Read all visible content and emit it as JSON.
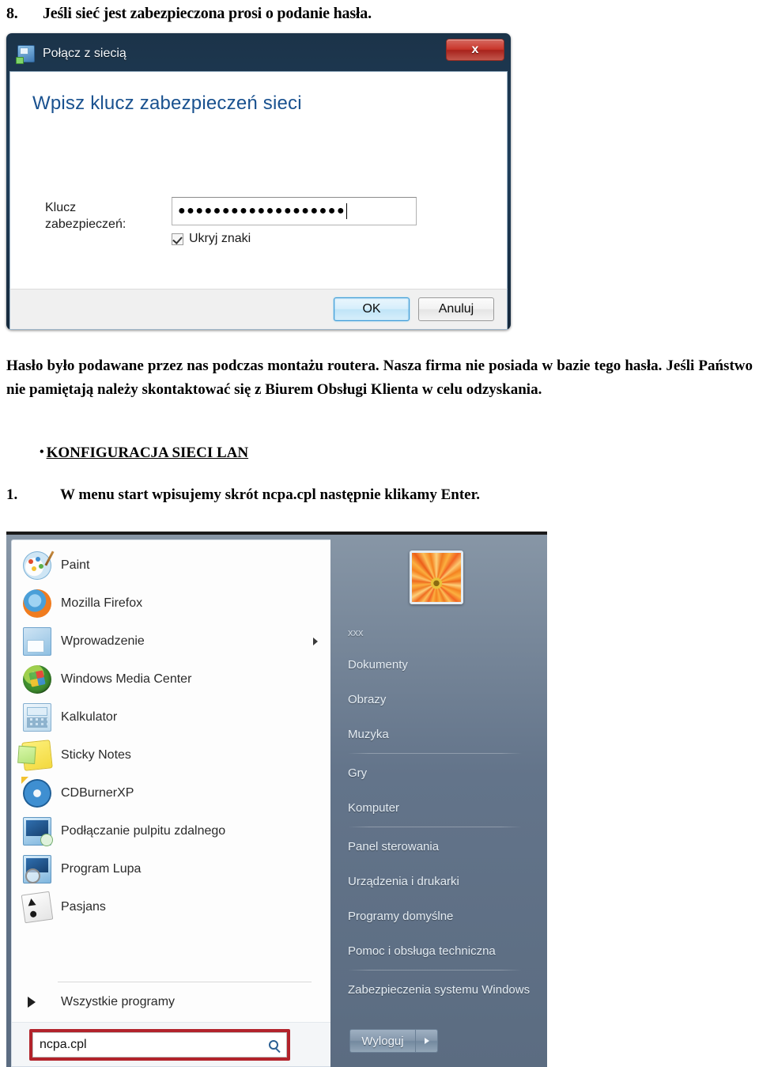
{
  "document": {
    "step8_number": "8.",
    "step8_text": "Jeśli sieć jest zabezpieczona prosi o podanie hasła.",
    "paragraph": "Hasło było podawane przez nas podczas montażu routera. Nasza firma nie posiada w bazie tego hasła. Jeśli Państwo nie pamiętają należy skontaktować się z Biurem Obsługi Klienta w celu odzyskania.",
    "bullet_heading": "KONFIGURACJA SIECI  LAN",
    "bullet_marker": "•",
    "step1_number": "1.",
    "step1_text_before": "W menu start wpisujemy skrót ",
    "step1_code": "ncpa.cpl",
    "step1_text_middle": " następnie klikamy ",
    "step1_bold_end": "Enter."
  },
  "dialog": {
    "title": "Połącz z siecią",
    "close_label": "x",
    "heading": "Wpisz klucz zabezpieczeń sieci",
    "field_label_line1": "Klucz",
    "field_label_line2": "zabezpieczeń:",
    "password_value": "●●●●●●●●●●●●●●●●●●●",
    "checkbox_label": "Ukryj znaki",
    "checkbox_checked": true,
    "ok_label": "OK",
    "cancel_label": "Anuluj"
  },
  "start_menu": {
    "programs": [
      {
        "label": "Paint",
        "icon": "paint-icon",
        "has_submenu": false
      },
      {
        "label": "Mozilla Firefox",
        "icon": "firefox-icon",
        "has_submenu": false
      },
      {
        "label": "Wprowadzenie",
        "icon": "getting-started-icon",
        "has_submenu": true
      },
      {
        "label": "Windows Media Center",
        "icon": "windows-media-center-icon",
        "has_submenu": false
      },
      {
        "label": "Kalkulator",
        "icon": "calculator-icon",
        "has_submenu": false
      },
      {
        "label": "Sticky Notes",
        "icon": "sticky-notes-icon",
        "has_submenu": false
      },
      {
        "label": "CDBurnerXP",
        "icon": "cdburnerxp-icon",
        "has_submenu": false
      },
      {
        "label": "Podłączanie pulpitu zdalnego",
        "icon": "remote-desktop-icon",
        "has_submenu": false
      },
      {
        "label": "Program Lupa",
        "icon": "magnifier-icon",
        "has_submenu": false
      },
      {
        "label": "Pasjans",
        "icon": "solitaire-icon",
        "has_submenu": false
      }
    ],
    "all_programs_label": "Wszystkie programy",
    "search_value": "ncpa.cpl",
    "search_icon": "search-icon",
    "user_name": "xxx",
    "avatar": "user-avatar-flower",
    "right_items": [
      "Dokumenty",
      "Obrazy",
      "Muzyka",
      "Gry",
      "Komputer",
      "Panel sterowania",
      "Urządzenia i drukarki",
      "Programy domyślne",
      "Pomoc i obsługa techniczna",
      "Zabezpieczenia systemu Windows"
    ],
    "logoff_label": "Wyloguj",
    "logoff_more_icon": "chevron-right-icon"
  },
  "colors": {
    "dialog_heading": "#19518f",
    "search_highlight": "#b2232b",
    "close_button": "#c8352a"
  }
}
